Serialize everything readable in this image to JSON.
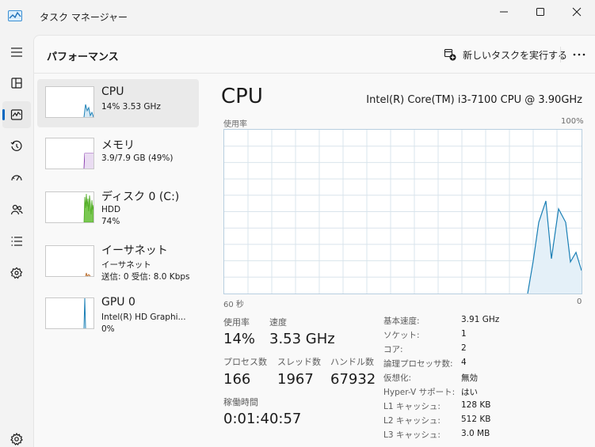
{
  "window": {
    "title": "タスク マネージャー"
  },
  "header": {
    "title": "パフォーマンス",
    "new_task_label": "新しいタスクを実行する"
  },
  "nav": [
    {
      "icon": "hamburger-menu-icon"
    },
    {
      "icon": "processes-icon"
    },
    {
      "icon": "performance-icon"
    },
    {
      "icon": "app-history-icon"
    },
    {
      "icon": "startup-apps-icon"
    },
    {
      "icon": "users-icon"
    },
    {
      "icon": "details-icon"
    },
    {
      "icon": "services-icon"
    },
    {
      "icon": "settings-icon"
    }
  ],
  "devices": [
    {
      "name": "CPU",
      "line1": "14%  3.53 GHz",
      "line2": "",
      "color": "#1a7fb5"
    },
    {
      "name": "メモリ",
      "line1": "3.9/7.9 GB (49%)",
      "line2": "",
      "color": "#8b3fb0"
    },
    {
      "name": "ディスク 0 (C:)",
      "line1": "HDD",
      "line2": "74%",
      "color": "#4caa1f"
    },
    {
      "name": "イーサネット",
      "line1": "イーサネット",
      "line2": "送信: 0 受信: 8.0 Kbps",
      "color": "#b96b2b"
    },
    {
      "name": "GPU 0",
      "line1": "Intel(R) HD Graphi...",
      "line2": "0%",
      "color": "#1a7fb5"
    }
  ],
  "main": {
    "title": "CPU",
    "model": "Intel(R) Core(TM) i3-7100 CPU @ 3.90GHz",
    "graph_label": "使用率",
    "graph_max": "100%",
    "graph_time": "60 秒",
    "graph_min": "0"
  },
  "stats": {
    "usage_label": "使用率",
    "usage_value": "14%",
    "speed_label": "速度",
    "speed_value": "3.53 GHz",
    "processes_label": "プロセス数",
    "processes_value": "166",
    "threads_label": "スレッド数",
    "threads_value": "1967",
    "handles_label": "ハンドル数",
    "handles_value": "67932",
    "uptime_label": "稼働時間",
    "uptime_value": "0:01:40:57"
  },
  "specs": [
    {
      "label": "基本速度:",
      "value": "3.91 GHz"
    },
    {
      "label": "ソケット:",
      "value": "1"
    },
    {
      "label": "コア:",
      "value": "2"
    },
    {
      "label": "論理プロセッサ数:",
      "value": "4"
    },
    {
      "label": "仮想化:",
      "value": "無効"
    },
    {
      "label": "Hyper-V サポート:",
      "value": "はい"
    },
    {
      "label": "L1 キャッシュ:",
      "value": "128 KB"
    },
    {
      "label": "L2 キャッシュ:",
      "value": "512 KB"
    },
    {
      "label": "L3 キャッシュ:",
      "value": "3.0 MB"
    }
  ],
  "colors": {
    "accent": "#0067c0",
    "cpu_line": "#1a7fb5",
    "grid": "#d9e4ec"
  }
}
